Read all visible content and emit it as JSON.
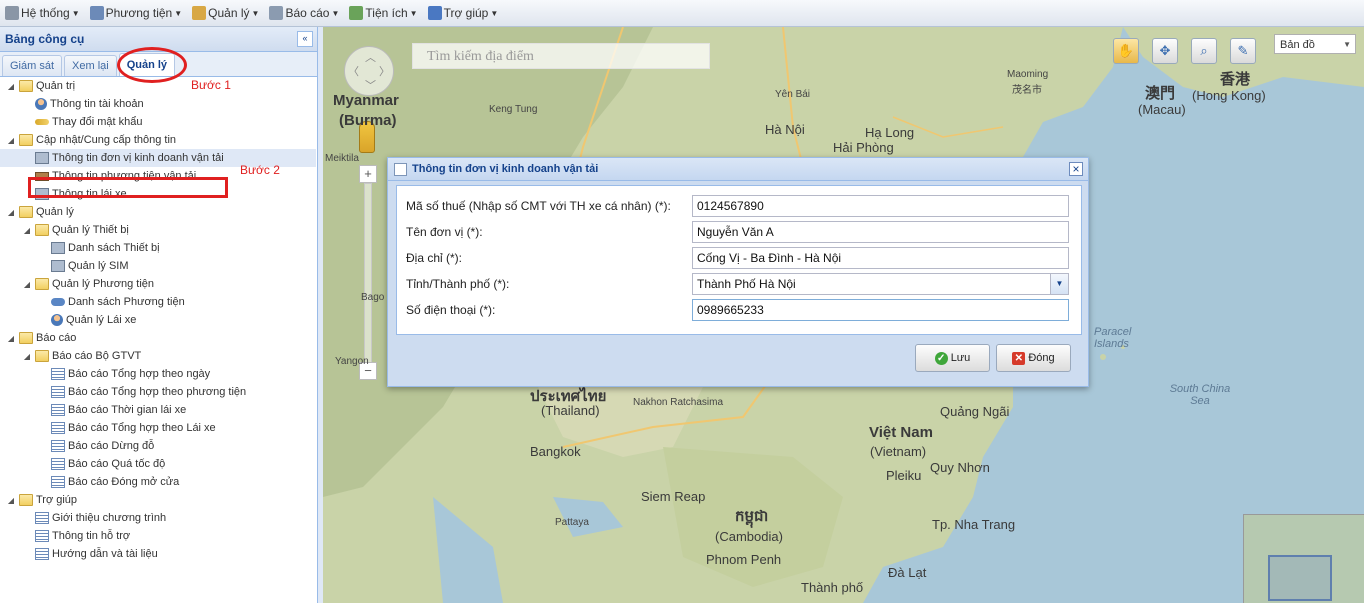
{
  "menubar": {
    "items": [
      {
        "label": "Hệ thống",
        "icon": "gear-icon",
        "color": "#8a96a6"
      },
      {
        "label": "Phương tiện",
        "icon": "vehicle-icon",
        "color": "#6c8ab8"
      },
      {
        "label": "Quản lý",
        "icon": "box-icon",
        "color": "#d8a845"
      },
      {
        "label": "Báo cáo",
        "icon": "report-icon",
        "color": "#8b9bb0"
      },
      {
        "label": "Tiện ích",
        "icon": "utilities-icon",
        "color": "#6aa35a"
      },
      {
        "label": "Trợ giúp",
        "icon": "help-icon",
        "color": "#4a78c2"
      }
    ]
  },
  "left_panel": {
    "title": "Bảng công cụ",
    "tabs": [
      "Giám sát",
      "Xem lại",
      "Quản lý"
    ],
    "active_tab": "Quản lý",
    "step1": "Bước 1",
    "step2": "Bước 2",
    "tree": [
      {
        "label": "Quản trị",
        "icon": "folder",
        "level": 0
      },
      {
        "label": "Thông tin tài khoản",
        "icon": "user",
        "level": 1
      },
      {
        "label": "Thay đổi mật khẩu",
        "icon": "key",
        "level": 1
      },
      {
        "label": "Cập nhật/Cung cấp thông tin",
        "icon": "folder",
        "level": 0
      },
      {
        "label": "Thông tin đơn vị kinh doanh vận tải",
        "icon": "device",
        "level": 1,
        "selected": true
      },
      {
        "label": "Thông tin phương tiện vận tải",
        "icon": "truck",
        "level": 1
      },
      {
        "label": "Thông tin lái xe",
        "icon": "device",
        "level": 1
      },
      {
        "label": "Quản lý",
        "icon": "folder",
        "level": 0
      },
      {
        "label": "Quản lý Thiết bị",
        "icon": "folder",
        "level": 1
      },
      {
        "label": "Danh sách Thiết bị",
        "icon": "device",
        "level": 2
      },
      {
        "label": "Quản lý SIM",
        "icon": "device",
        "level": 2
      },
      {
        "label": "Quản lý Phương tiện",
        "icon": "folder",
        "level": 1
      },
      {
        "label": "Danh sách Phương tiện",
        "icon": "car",
        "level": 2
      },
      {
        "label": "Quản lý Lái xe",
        "icon": "user",
        "level": 2
      },
      {
        "label": "Báo cáo",
        "icon": "folder",
        "level": 0
      },
      {
        "label": "Báo cáo Bộ GTVT",
        "icon": "folder",
        "level": 1
      },
      {
        "label": "Báo cáo Tổng hợp theo ngày",
        "icon": "report",
        "level": 2
      },
      {
        "label": "Báo cáo Tổng hợp theo phương tiện",
        "icon": "report",
        "level": 2
      },
      {
        "label": "Báo cáo Thời gian lái xe",
        "icon": "report",
        "level": 2
      },
      {
        "label": "Báo cáo Tổng hợp theo Lái xe",
        "icon": "report",
        "level": 2
      },
      {
        "label": "Báo cáo Dừng đỗ",
        "icon": "report",
        "level": 2
      },
      {
        "label": "Báo cáo Quá tốc độ",
        "icon": "report",
        "level": 2
      },
      {
        "label": "Báo cáo Đóng mở cửa",
        "icon": "report",
        "level": 2
      },
      {
        "label": "Trợ giúp",
        "icon": "folder",
        "level": 0
      },
      {
        "label": "Giới thiệu chương trình",
        "icon": "report",
        "level": 1
      },
      {
        "label": "Thông tin hỗ trợ",
        "icon": "report",
        "level": 1
      },
      {
        "label": "Hướng dẫn và tài liệu",
        "icon": "report",
        "level": 1
      }
    ]
  },
  "map": {
    "search_placeholder": "Tìm kiếm địa điểm",
    "map_type": "Bản đồ",
    "labels": {
      "myanmar": "Myanmar",
      "burma": "(Burma)",
      "macau_cn": "澳門",
      "macau": "(Macau)",
      "hk_cn": "香港",
      "hk": "(Hong Kong)",
      "hanoi": "Hà Nội",
      "haiphong": "Hải Phòng",
      "halong": "Hạ Long",
      "maoming": "Maoming",
      "maoming_cn": "茂名市",
      "yenbai": "Yên Bái",
      "thailand_th": "ประเทศไทย",
      "thailand": "(Thailand)",
      "bangkok": "Bangkok",
      "vietnam": "Việt Nam",
      "vietnam_en": "(Vietnam)",
      "cambodia_km": "កម្ពុជា",
      "cambodia": "(Cambodia)",
      "phnompenh": "Phnom Penh",
      "siemreap": "Siem Reap",
      "nakhon": "Nakhon Ratchasima",
      "pattaya": "Pattaya",
      "quangngai": "Quảng Ngãi",
      "quynhon": "Quy Nhơn",
      "nhatrang": "Tp. Nha Trang",
      "dalat": "Đà Lạt",
      "pleiku": "Pleiku",
      "thanhpho": "Thành phố",
      "paracel": "Paracel Islands",
      "southchinasea": "South China Sea",
      "yangon": "Yangon",
      "meiktila": "Meiktila",
      "bago": "Bago",
      "kengtung": "Keng Tung"
    }
  },
  "dialog": {
    "title": "Thông tin đơn vị kinh doanh vận tải",
    "fields": [
      {
        "label": "Mã số thuế (Nhập số CMT với TH xe cá nhân) (*):",
        "value": "0124567890"
      },
      {
        "label": "Tên đơn vị (*):",
        "value": "Nguyễn Văn A"
      },
      {
        "label": "Địa chỉ (*):",
        "value": "Cống Vị - Ba Đình - Hà Nội"
      },
      {
        "label": "Tỉnh/Thành phố (*):",
        "value": "Thành Phố Hà Nội"
      },
      {
        "label": "Số điện thoại (*):",
        "value": "0989665233"
      }
    ],
    "save_label": "Lưu",
    "close_label": "Đóng"
  }
}
